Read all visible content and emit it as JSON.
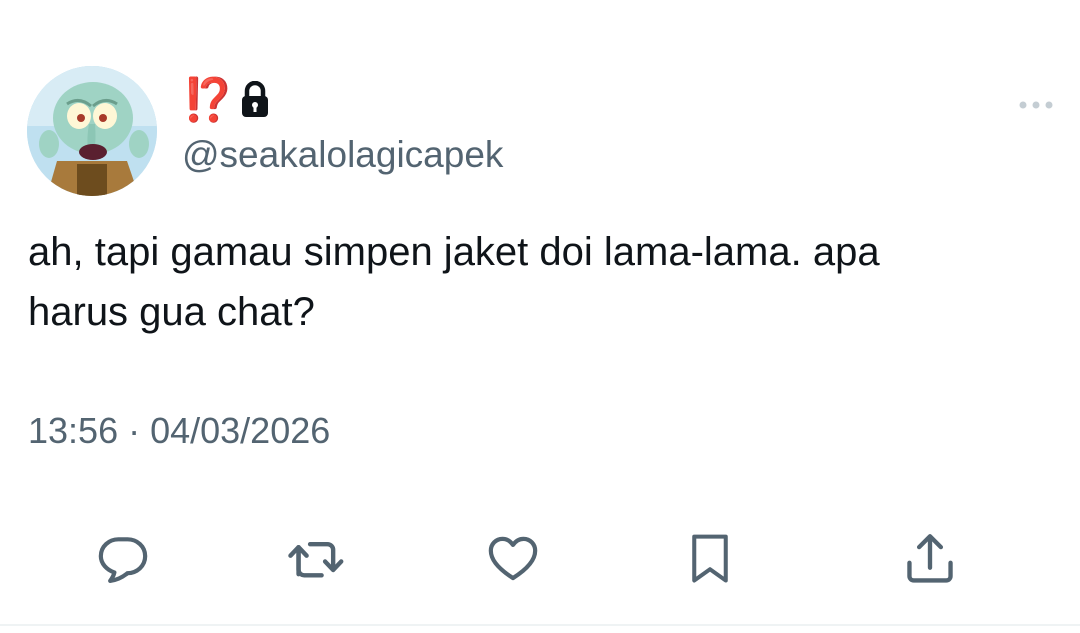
{
  "tweet": {
    "display_name": "⁉️",
    "handle": "@seakalolagicapek",
    "text": "ah, tapi gamau simpen jaket doi lama-lama. apa\nharus gua chat?",
    "timestamp": "13:56 · 04/03/2026",
    "protected": true
  },
  "icons": {
    "avatar": "squidward-avatar",
    "protected": "lock-icon",
    "more": "more-options-icon",
    "actions": [
      "reply-icon",
      "retweet-icon",
      "like-icon",
      "bookmark-icon",
      "share-icon"
    ]
  },
  "colors": {
    "text": "#0f1419",
    "secondary": "#536471",
    "icon": "#536471",
    "name_accent": "#e0245e"
  }
}
